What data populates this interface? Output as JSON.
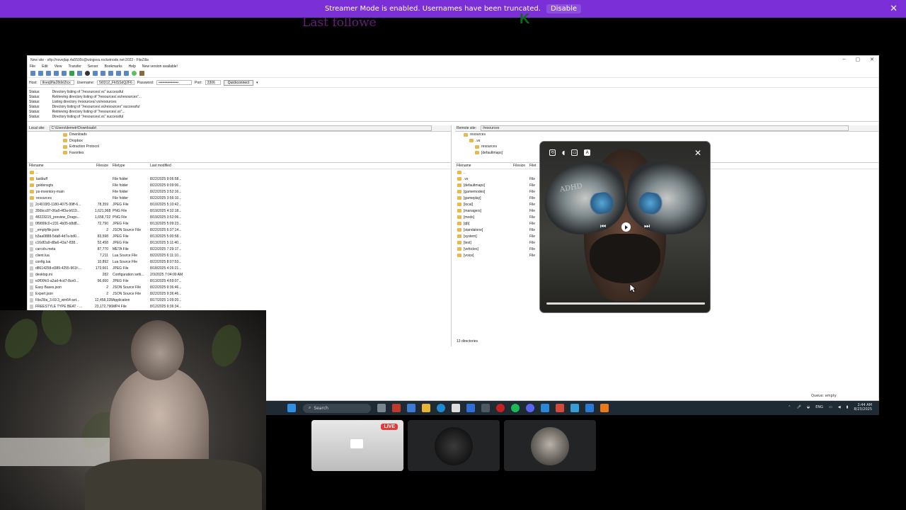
{
  "banner": {
    "message": "Streamer Mode is enabled. Usernames have been truncated.",
    "disable_label": "Disable"
  },
  "overlay": {
    "last_follower": "Last followe",
    "logo_text": "K"
  },
  "filezilla": {
    "title": "New site - sftp://novejlap.4a5590c@wingsva.rocketnode.net:2022 - FileZilla",
    "menus": [
      "File",
      "Edit",
      "View",
      "Transfer",
      "Server",
      "Bookmarks",
      "Help",
      "New version available!"
    ],
    "quickconnect": {
      "host_label": "Host:",
      "host_value": "tlneq9fia28dxl2tcx",
      "user_label": "Username:",
      "user_value": "5i0312_FktSSdQ2F6",
      "pass_label": "Password:",
      "pass_value": "••••••••••••••••",
      "port_label": "Port:",
      "port_value": "3306",
      "button": "Quickconnect"
    },
    "log": [
      {
        "k": "Status:",
        "v": "Directory listing of \"/resources/.vs\" successful"
      },
      {
        "k": "Status:",
        "v": "Retrieving directory listing of \"/resources/.vs/resources\"..."
      },
      {
        "k": "Status:",
        "v": "Listing directory /resources/.vs/resources"
      },
      {
        "k": "Status:",
        "v": "Directory listing of \"/resources/.vs/resources\" successful"
      },
      {
        "k": "Status:",
        "v": "Retrieving directory listing of \"/resources/.vs\"..."
      },
      {
        "k": "Status:",
        "v": "Directory listing of \"/resources/.vs\" successful"
      }
    ],
    "local": {
      "site_label": "Local site:",
      "site_path": "C:\\Users\\demetr\\Downloads\\",
      "tree": [
        "Downloads",
        "Dropbox",
        "Extraction Protocol",
        "Favorites"
      ],
      "headers": [
        "Filename",
        "Filesize",
        "Filetype",
        "Last modified"
      ],
      "rows": [
        [
          "..",
          "",
          "",
          ""
        ],
        [
          "lastbuff",
          "",
          "File folder",
          "8/22/2025 9:06:58..."
        ],
        [
          "goldensgts",
          "",
          "File folder",
          "8/22/2025 9:09:00..."
        ],
        [
          "ps-inventory-main",
          "",
          "File folder",
          "8/22/2025 3:52:16..."
        ],
        [
          "resources",
          "",
          "File folder",
          "8/22/2025 3:56:10..."
        ],
        [
          "2c4019f3-1180-4075-99ff-6...",
          "78,359",
          "JPEG File",
          "8/10/2025 5:10:42..."
        ],
        [
          "356bcc87-06a0-4f3a-b619...",
          "1,621,968",
          "PNG File",
          "8/19/2025 4:32:18..."
        ],
        [
          "48223215_preview_Drago...",
          "1,658,722",
          "PNG File",
          "8/19/2025 3:52:06..."
        ],
        [
          "0f9899c0-c231-4b35-b8d8...",
          "72,790",
          "JPEG File",
          "8/13/2025 5:09:23..."
        ],
        [
          "_emptyfile.json",
          "2",
          "JSON Source File",
          "8/22/2025 6:37:14..."
        ],
        [
          "b3aa0888-5da8-4d7a-bd0...",
          "83,598",
          "JPEG File",
          "8/13/2025 5:00:58..."
        ],
        [
          "c16df2a9-d8a6-43a7-838...",
          "52,458",
          "JPEG File",
          "8/13/2025 5:11:40..."
        ],
        [
          "carcols.meta",
          "87,770",
          "META File",
          "8/22/2025 7:29:17..."
        ],
        [
          "client.lua",
          "7,211",
          "Lua Source File",
          "8/22/2025 6:11:10..."
        ],
        [
          "config.lua",
          "10,892",
          "Lua Source File",
          "8/22/2025 8:07:53..."
        ],
        [
          "d8614258-d389-4255-961f-...",
          "173,661",
          "JPEG File",
          "8/18/2025 4:26:21..."
        ],
        [
          "desktop.ini",
          "282",
          "Configuration setti...",
          "2/3/2025 7:04:09 AM"
        ],
        [
          "e0f00fc0-a2ad-4cd7-8ce0...",
          "96,660",
          "JPEG File",
          "8/13/2025 4:59:07..."
        ],
        [
          "Easy Bases.json",
          "2",
          "JSON Source File",
          "8/22/2025 9:36:46..."
        ],
        [
          "Expert.json",
          "2",
          "JSON Source File",
          "8/22/2025 9:36:46..."
        ],
        [
          "FileZilla_3.69.3_win64-set...",
          "12,458,328",
          "Application",
          "8/17/2025 1:09:20..."
        ],
        [
          "FREESTYLE TYPE BEAT - ...",
          "23,172,796",
          "MP4 File",
          "8/12/2025 9:36:34..."
        ]
      ]
    },
    "remote": {
      "site_label": "Remote site:",
      "site_path": "/resources",
      "tree": [
        "resources",
        ".vs",
        "resources",
        "[defaultmaps]"
      ],
      "headers": [
        "Filename",
        "Filesize",
        "Filet"
      ],
      "rows": [
        "..",
        ".vs",
        "[defaultmaps]",
        "[gamemodes]",
        "[gameplay]",
        "[local]",
        "[managers]",
        "[mods]",
        "[qb]",
        "[standalone]",
        "[system]",
        "[test]",
        "[vehicles]",
        "[voice]"
      ],
      "type_label": "File",
      "footer": "13 directories"
    },
    "queue": "Queue: empty"
  },
  "player": {
    "art_text": "ADHD"
  },
  "taskbar": {
    "search_label": "Search",
    "lang": "ENG",
    "time": "2:44 AM",
    "date": "8/23/2025"
  },
  "tiles": {
    "live_label": "LIVE"
  },
  "colors": {
    "banner": "#7b2fd6",
    "live": "#e23b3b",
    "taskbar": "#1f2a33"
  }
}
